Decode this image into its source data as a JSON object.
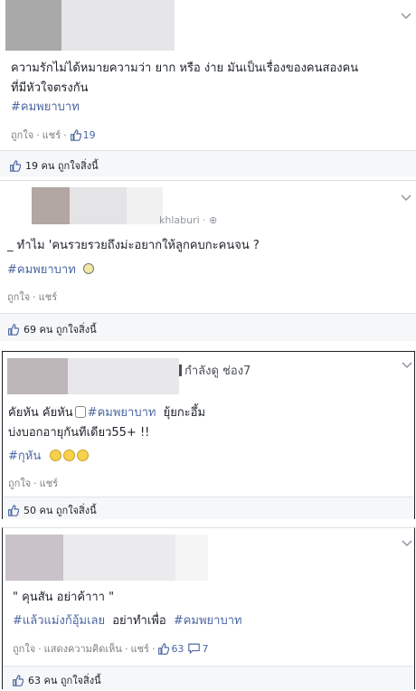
{
  "posts": [
    {
      "text_line1": "ความรักไม่ได้หมายความว่า ยาก หรือ ง่าย มันเป็นเรื่องของคนสองคน",
      "text_line2": "ที่มีหัวใจตรงกัน",
      "hashtag": "#คมพยาบาท",
      "like_label": "ถูกใจ",
      "share_label": "แชร์",
      "like_count": "19",
      "footer_text": "19 คน ถูกใจสิ่งนี้"
    },
    {
      "page_fragment": "khlaburi",
      "text_line1": "_ ทำไม 'คนรวยรวยถึงม่ะอยากให้ลูกคบกะคนจน ?",
      "hashtag": "#คมพยาบาท",
      "like_label": "ถูกใจ",
      "share_label": "แชร์",
      "footer_text": "69 คน ถูกใจสิ่งนี้"
    },
    {
      "channel": "กำลังดู ช่อง7",
      "text_line1_a": "คัยหัน คัยหัน",
      "text_line1_tag": "#คมพยาบาท",
      "text_line1_b": "ยุ้ยกะอึ้ม",
      "text_line2": "บ่งบอกอายุกันทีเดียว55+ !!",
      "hashtag": "#กุหัน",
      "like_label": "ถูกใจ",
      "share_label": "แชร์",
      "footer_text": "50 คน ถูกใจสิ่งนี้"
    },
    {
      "text_line1": "\" คุนสัน อย่าค้าาา \"",
      "text_tag1": "#แล้วแม่งก้อุ้มเลย",
      "text_mid": "อย่าทำเพื่อ",
      "text_tag2": "#คมพยาบาท",
      "like_label": "ถูกใจ",
      "comment_label": "แสดงความคิดเห็น",
      "share_label": "แชร์",
      "like_count": "63",
      "comment_count": "7",
      "footer_text": "63 คน ถูกใจสิ่งนี้"
    }
  ],
  "colors": {
    "link": "#4b67a1",
    "footer_bg": "#f6f7f9",
    "border": "#dddfe2"
  }
}
